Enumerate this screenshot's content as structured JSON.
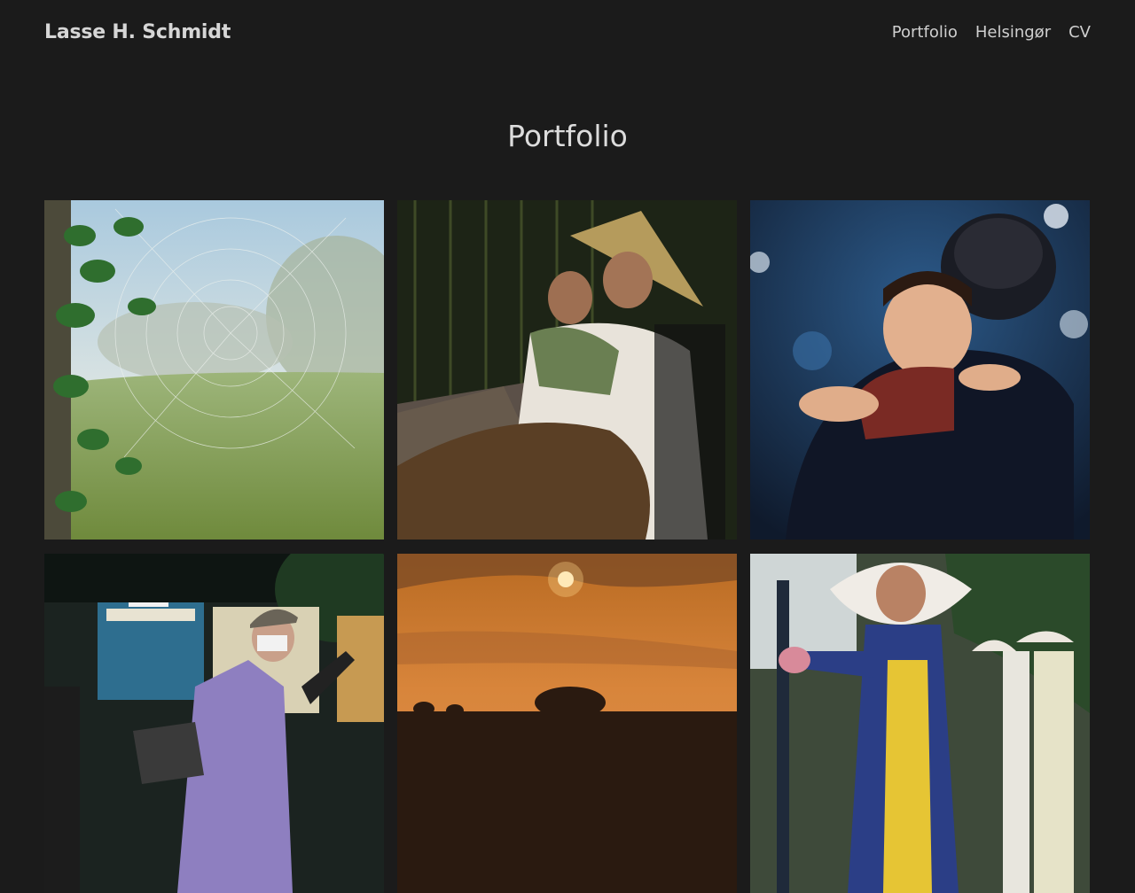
{
  "site": {
    "title": "Lasse H. Schmidt"
  },
  "nav": {
    "items": [
      {
        "label": "Portfolio"
      },
      {
        "label": "Helsingør"
      },
      {
        "label": "CV"
      }
    ]
  },
  "page": {
    "title": "Portfolio"
  },
  "gallery": {
    "photos": [
      {
        "icon": "misty-meadow-spiderweb-photo"
      },
      {
        "icon": "mother-and-child-conical-hat-photo"
      },
      {
        "icon": "child-hugging-father-helmet-photo"
      },
      {
        "icon": "masked-man-on-scooter-night-photo"
      },
      {
        "icon": "orange-sunset-trees-photo"
      },
      {
        "icon": "woman-conical-hat-street-photo"
      }
    ]
  },
  "colors": {
    "background": "#1b1b1b",
    "text": "#d8d8d8"
  }
}
